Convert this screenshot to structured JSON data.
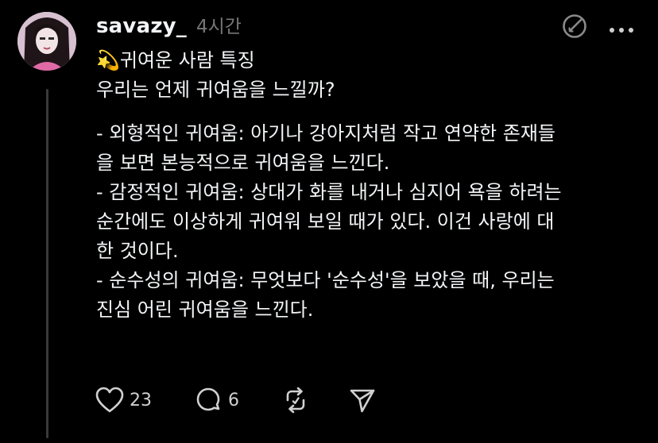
{
  "post": {
    "username": "savazy_",
    "time": "4시간",
    "title": "💫귀여운 사람 특징",
    "question": "우리는 언제 귀여움을 느낄까?",
    "lines": [
      "- 외형적인 귀여움: 아기나 강아지처럼 작고 연약한 존재들",
      "을 보면 본능적으로 귀여움을 느낀다.",
      "- 감정적인 귀여움: 상대가 화를 내거나 심지어 욕을 하려는",
      "순간에도 이상하게 귀여워 보일 때가 있다. 이건 사랑에 대",
      "한 것이다.",
      "- 순수성의 귀여움: 무엇보다 '순수성'을 보았을 때, 우리는",
      "진심 어린 귀여움을 느낀다."
    ]
  },
  "actions": {
    "likes": "23",
    "comments": "6"
  },
  "icons": [
    "heart-icon",
    "comment-icon",
    "repost-icon",
    "share-icon",
    "edit-icon",
    "more-icon"
  ],
  "colors": {
    "background": "#000000",
    "text": "#f3f5f7",
    "muted": "#777777",
    "thread_line": "#3a3a3a"
  }
}
